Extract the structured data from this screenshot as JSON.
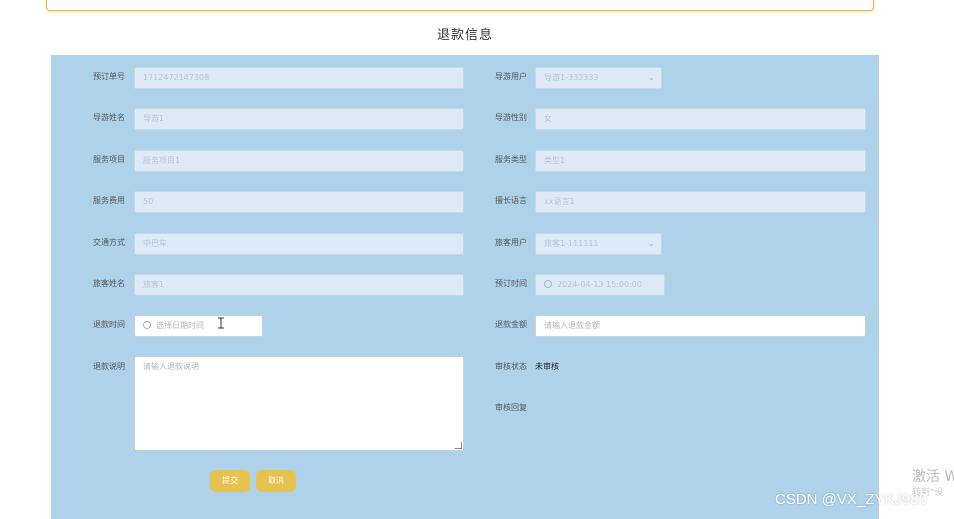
{
  "page_title": "退款信息",
  "form": {
    "order_no_label": "预订单号",
    "order_no_value": "1712472147308",
    "guide_user_label": "导游用户",
    "guide_user_value": "导游1-333333",
    "guide_name_label": "导游姓名",
    "guide_name_value": "导游1",
    "guide_gender_label": "导游性别",
    "guide_gender_value": "女",
    "service_item_label": "服务项目",
    "service_item_value": "服务项目1",
    "service_type_label": "服务类型",
    "service_type_value": "类型1",
    "service_fee_label": "服务费用",
    "service_fee_value": "50",
    "language_label": "擅长语言",
    "language_value": "xx语言1",
    "transport_label": "交通方式",
    "transport_value": "中巴车",
    "tourist_user_label": "旅客用户",
    "tourist_user_value": "旅客1-111111",
    "tourist_name_label": "旅客姓名",
    "tourist_name_value": "旅客1",
    "booking_time_label": "预订时间",
    "booking_time_value": "2024-04-13 15:00:00",
    "refund_time_label": "退款时间",
    "refund_time_placeholder": "选择日期时间",
    "refund_amount_label": "退款金额",
    "refund_amount_placeholder": "请输入退款金额",
    "refund_desc_label": "退款说明",
    "refund_desc_placeholder": "请输入退款说明",
    "review_status_label": "审核状态",
    "review_status_value": "未审核",
    "review_reply_label": "审核回复"
  },
  "buttons": {
    "submit": "提交",
    "cancel": "取消"
  },
  "overlay": {
    "activate_text": "激活 W",
    "activate_sub": "转到\"设",
    "csdn_watermark": "CSDN @VX_ZYKJ985"
  },
  "colors": {
    "panel_bg": "#aed2ea",
    "button_bg": "#e6c34f",
    "disabled_field_bg": "#deeaf5"
  },
  "icons": {
    "select_arrow": "chevron-down-icon",
    "time": "clock-icon",
    "text_cursor": "text-cursor-icon"
  }
}
